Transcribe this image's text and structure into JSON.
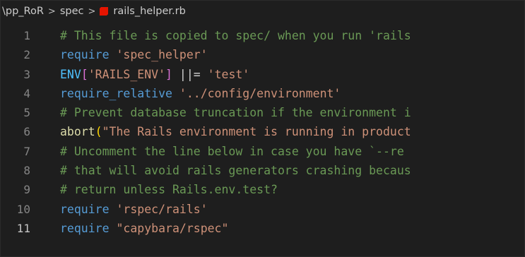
{
  "breadcrumb": {
    "folder": "\\pp_RoR",
    "sep": ">",
    "subfolder": "spec",
    "file": "rails_helper.rb"
  },
  "colors": {
    "background": "#1e1e1e",
    "comment": "#6a9955",
    "keyword": "#569cd6",
    "string": "#ce9178",
    "constant": "#4fc1ff",
    "ruby_icon": "#e51400"
  },
  "lines": [
    {
      "n": "1",
      "tokens": [
        {
          "t": "# This file is copied to spec/ when you run 'rails",
          "c": "t-comment"
        }
      ]
    },
    {
      "n": "2",
      "tokens": [
        {
          "t": "require",
          "c": "t-kw"
        },
        {
          "t": " ",
          "c": "t-op"
        },
        {
          "t": "'spec_helper'",
          "c": "t-str"
        }
      ]
    },
    {
      "n": "3",
      "tokens": [
        {
          "t": "ENV",
          "c": "t-const"
        },
        {
          "t": "[",
          "c": "t-bracket"
        },
        {
          "t": "'RAILS_ENV'",
          "c": "t-str"
        },
        {
          "t": "]",
          "c": "t-bracket"
        },
        {
          "t": " ||= ",
          "c": "t-op"
        },
        {
          "t": "'test'",
          "c": "t-str"
        }
      ]
    },
    {
      "n": "4",
      "tokens": [
        {
          "t": "require_relative",
          "c": "t-kw"
        },
        {
          "t": " ",
          "c": "t-op"
        },
        {
          "t": "'../config/environment'",
          "c": "t-str"
        }
      ]
    },
    {
      "n": "5",
      "tokens": [
        {
          "t": "# Prevent database truncation if the environment i",
          "c": "t-comment"
        }
      ]
    },
    {
      "n": "6",
      "tokens": [
        {
          "t": "abort",
          "c": "t-fn"
        },
        {
          "t": "(",
          "c": "t-paren"
        },
        {
          "t": "\"The Rails environment is running in product",
          "c": "t-str"
        }
      ]
    },
    {
      "n": "7",
      "tokens": [
        {
          "t": "# Uncomment the line below in case you have `--re",
          "c": "t-comment"
        }
      ]
    },
    {
      "n": "8",
      "tokens": [
        {
          "t": "# that will avoid rails generators crashing becaus",
          "c": "t-comment"
        }
      ]
    },
    {
      "n": "9",
      "tokens": [
        {
          "t": "# return unless Rails.env.test?",
          "c": "t-comment"
        }
      ]
    },
    {
      "n": "10",
      "tokens": [
        {
          "t": "require",
          "c": "t-kw"
        },
        {
          "t": " ",
          "c": "t-op"
        },
        {
          "t": "'rspec/rails'",
          "c": "t-str"
        }
      ]
    },
    {
      "n": "11",
      "tokens": [
        {
          "t": "require",
          "c": "t-kw"
        },
        {
          "t": " ",
          "c": "t-op"
        },
        {
          "t": "\"capybara/rspec\"",
          "c": "t-str"
        }
      ],
      "active": true
    }
  ]
}
